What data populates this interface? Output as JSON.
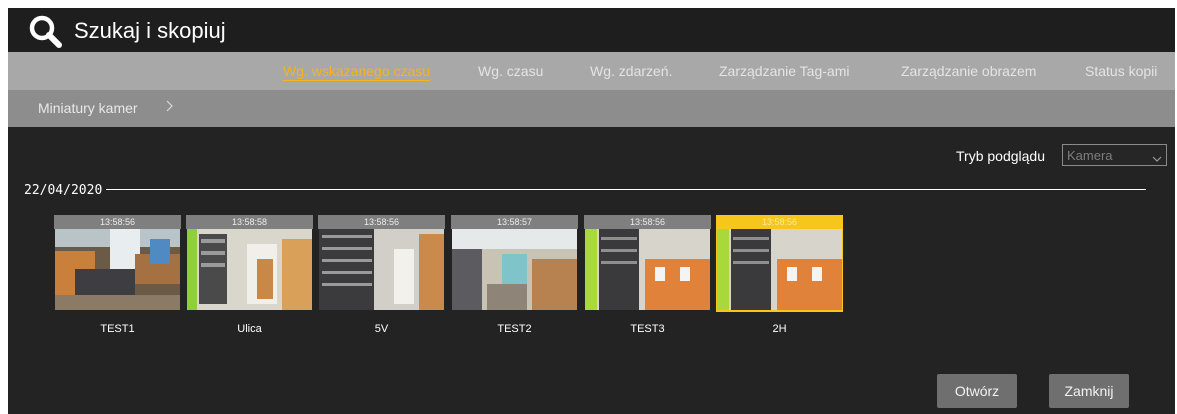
{
  "window": {
    "title": "Szukaj i skopiuj",
    "title_icon": "search-icon"
  },
  "tabs": [
    {
      "label": "Wg. wskazanego czasu",
      "active": true
    },
    {
      "label": "Wg. czasu",
      "active": false
    },
    {
      "label": "Wg. zdarzeń.",
      "active": false
    },
    {
      "label": "Zarządzanie Tag-ami",
      "active": false
    },
    {
      "label": "Zarządzanie obrazem",
      "active": false
    },
    {
      "label": "Status kopii",
      "active": false
    }
  ],
  "breadcrumb": {
    "label": "Miniatury kamer",
    "icon": "chevron-right-icon"
  },
  "preview_mode": {
    "label": "Tryb podglądu",
    "value": "Kamera"
  },
  "date": "22/04/2020",
  "cameras": [
    {
      "name": "TEST1",
      "time": "13:58:56",
      "selected": false
    },
    {
      "name": "Ulica",
      "time": "13:58:58",
      "selected": false
    },
    {
      "name": "5V",
      "time": "13:58:56",
      "selected": false
    },
    {
      "name": "TEST2",
      "time": "13:58:57",
      "selected": false
    },
    {
      "name": "TEST3",
      "time": "13:58:56",
      "selected": false
    },
    {
      "name": "2H",
      "time": "13:58:56",
      "selected": true
    }
  ],
  "buttons": {
    "open": "Otwórz",
    "close": "Zamknij"
  },
  "colors": {
    "accent": "#f7b31a",
    "selected_thumb": "#f7c61a",
    "background": "#232323"
  }
}
